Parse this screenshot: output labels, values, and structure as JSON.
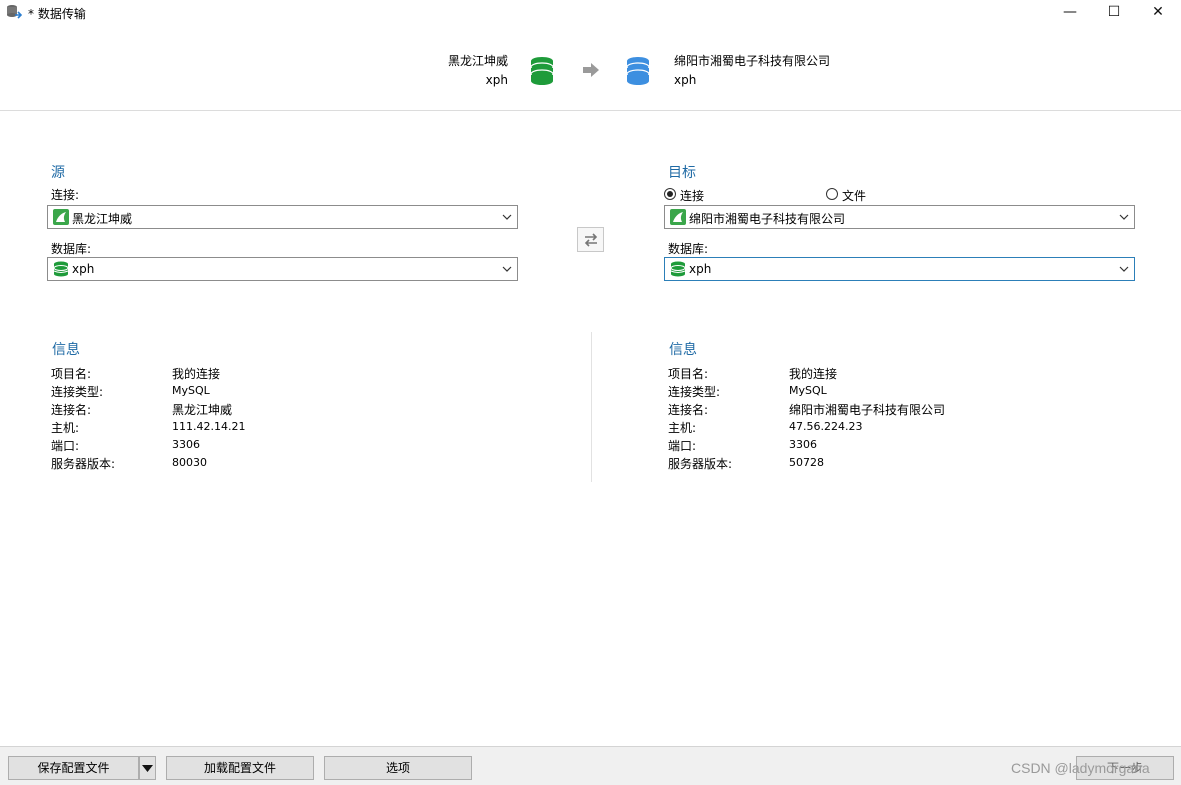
{
  "window": {
    "title": "* 数据传输",
    "minimize_symbol": "—",
    "maximize_symbol": "☐",
    "close_symbol": "✕"
  },
  "banner": {
    "source_connection": "黑龙江坤威",
    "source_database": "xph",
    "target_connection": "绵阳市湘蜀电子科技有限公司",
    "target_database": "xph",
    "source_icon": "database-green-icon",
    "target_icon": "database-blue-icon",
    "arrow_icon": "arrow-right-icon"
  },
  "source": {
    "title": "源",
    "connection_label": "连接:",
    "connection_value": "黑龙江坤威",
    "database_label": "数据库:",
    "database_value": "xph"
  },
  "target": {
    "title": "目标",
    "radio_connection": "连接",
    "radio_file": "文件",
    "selected_radio": "连接",
    "connection_value": "绵阳市湘蜀电子科技有限公司",
    "database_label": "数据库:",
    "database_value": "xph"
  },
  "source_info": {
    "title": "信息",
    "rows": [
      {
        "key": "项目名:",
        "value": "我的连接"
      },
      {
        "key": "连接类型:",
        "value": "MySQL"
      },
      {
        "key": "连接名:",
        "value": "黑龙江坤威"
      },
      {
        "key": "主机:",
        "value": "111.42.14.21"
      },
      {
        "key": "端口:",
        "value": "3306"
      },
      {
        "key": "服务器版本:",
        "value": "80030"
      }
    ]
  },
  "target_info": {
    "title": "信息",
    "rows": [
      {
        "key": "项目名:",
        "value": "我的连接"
      },
      {
        "key": "连接类型:",
        "value": "MySQL"
      },
      {
        "key": "连接名:",
        "value": "绵阳市湘蜀电子科技有限公司"
      },
      {
        "key": "主机:",
        "value": "47.56.224.23"
      },
      {
        "key": "端口:",
        "value": "3306"
      },
      {
        "key": "服务器版本:",
        "value": "50728"
      }
    ]
  },
  "footer": {
    "save_config": "保存配置文件",
    "load_config": "加载配置文件",
    "options": "选项",
    "next": "下一步",
    "watermark": "CSDN @ladymorgana"
  },
  "colors": {
    "section_title": "#1f6aa5",
    "db_green": "#1e9b3a",
    "db_blue": "#3d8fe0"
  }
}
